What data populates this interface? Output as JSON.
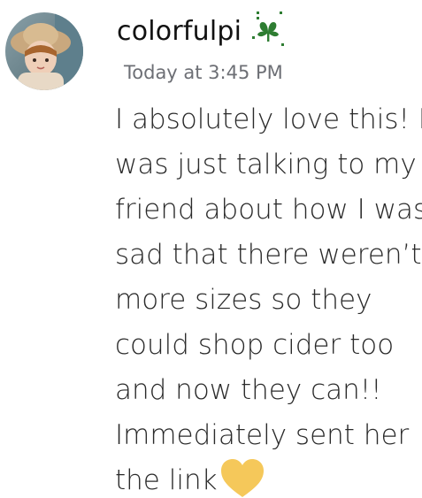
{
  "message": {
    "username": "colorfulpi",
    "timestamp": "Today at 3:45 PM",
    "lines": [
      "I absolutely love this! I",
      "was just talking to my",
      "friend about how I was",
      "sad that there weren’t",
      "more sizes so they",
      "could shop cider too",
      "and now they can!!",
      "Immediately sent her",
      "the link"
    ],
    "trailing_emoji": "yellow-heart-icon",
    "badge_icon": "leaf-sparkle-icon"
  },
  "colors": {
    "username": "#111111",
    "timestamp": "#6d6f75",
    "text": "#2a2a2a",
    "badge_green": "#2e7d32",
    "heart_yellow": "#f5c85a"
  }
}
